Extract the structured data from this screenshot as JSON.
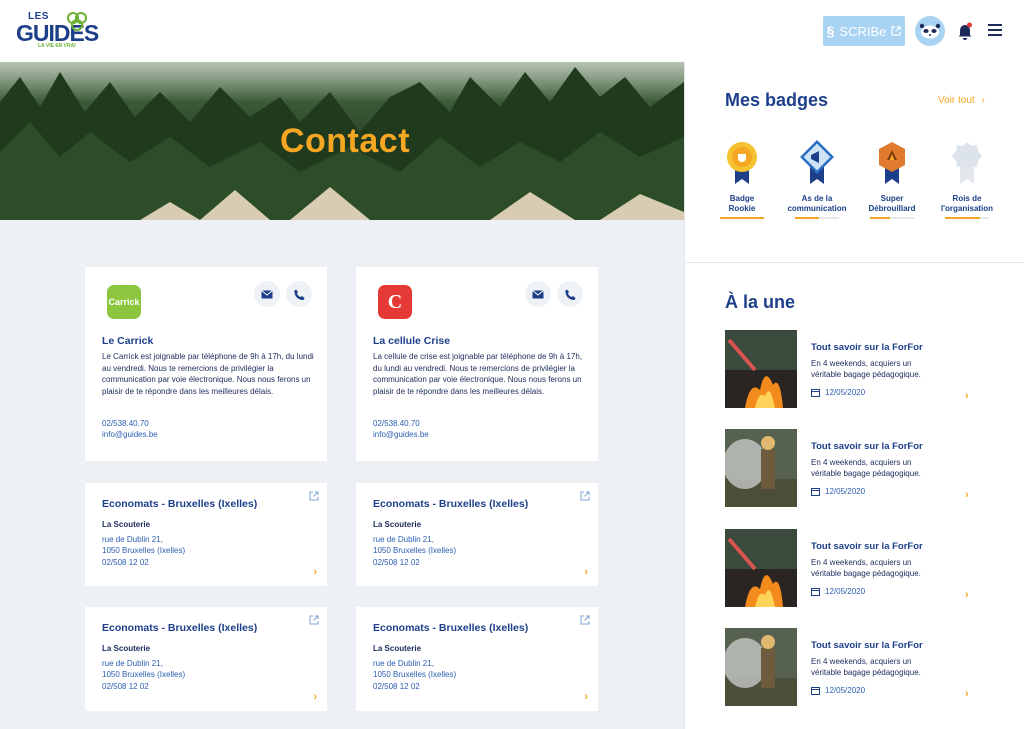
{
  "header": {
    "logo_top": "LES",
    "logo_main": "GUIDES",
    "logo_tagline": "LA VIE EN VRAI",
    "scribe_label": "SCRIBe"
  },
  "hero": {
    "title": "Contact"
  },
  "contacts": [
    {
      "name": "Le Carrick",
      "logo_text": "Carrick",
      "description": "Le Carrick est joignable par téléphone de 9h à 17h, du lundi au vendredi. Nous te remercions de privilégier la communication par voie électronique. Nous nous ferons un plaisir de te répondre dans les meilleures délais.",
      "phone": "02/538.40.70",
      "email": "info@guides.be"
    },
    {
      "name": "La cellule Crise",
      "logo_text": "C",
      "description": "La cellule de crise  est joignable par téléphone de 9h à 17h, du lundi au vendredi. Nous te remercions de privilégier la communication par voie électronique. Nous nous ferons un plaisir de te répondre dans les meilleures délais.",
      "phone": "02/538.40.70",
      "email": "info@guides.be"
    }
  ],
  "shops": [
    {
      "title": "Economats - Bruxelles (Ixelles)",
      "store": "La Scouterie",
      "street": "rue de Dublin 21,",
      "city": "1050 Bruxelles (Ixelles)",
      "phone": "02/508 12 02"
    },
    {
      "title": "Economats - Bruxelles (Ixelles)",
      "store": "La Scouterie",
      "street": "rue de Dublin 21,",
      "city": "1050 Bruxelles (Ixelles)",
      "phone": "02/508 12 02"
    },
    {
      "title": "Economats - Bruxelles (Ixelles)",
      "store": "La Scouterie",
      "street": "rue de Dublin 21,",
      "city": "1050 Bruxelles (Ixelles)",
      "phone": "02/508 12 02"
    },
    {
      "title": "Economats - Bruxelles (Ixelles)",
      "store": "La Scouterie",
      "street": "rue de Dublin 21,",
      "city": "1050 Bruxelles (Ixelles)",
      "phone": "02/508 12 02"
    }
  ],
  "sidebar": {
    "badges_title": "Mes badges",
    "see_all": "Voir tout",
    "badges": [
      {
        "line1": "Badge",
        "line2": "Rookie",
        "color": "#f5a623",
        "progress": 1.0
      },
      {
        "line1": "As de la",
        "line2": "communication",
        "color": "#2a6fc2",
        "progress": 0.55
      },
      {
        "line1": "Super",
        "line2": "Débrouillard",
        "color": "#e07a2e",
        "progress": 0.45
      },
      {
        "line1": "Rois de",
        "line2": "l'organisation",
        "color": "#c9d3df",
        "progress": 0.8
      }
    ],
    "news_title": "À la une",
    "news": [
      {
        "title": "Tout savoir sur la ForFor",
        "desc": "En 4 weekends, acquiers un véritable bagage pédagogique.",
        "date": "12/05/2020",
        "image": "fire"
      },
      {
        "title": "Tout savoir sur la ForFor",
        "desc": "En 4 weekends, acquiers un véritable bagage pédagogique.",
        "date": "12/05/2020",
        "image": "smoke"
      },
      {
        "title": "Tout savoir sur la ForFor",
        "desc": "En 4 weekends, acquiers un véritable bagage pédagogique.",
        "date": "12/05/2020",
        "image": "fire"
      },
      {
        "title": "Tout savoir sur la ForFor",
        "desc": "En 4 weekends, acquiers un véritable bagage pédagogique.",
        "date": "12/05/2020",
        "image": "smoke"
      }
    ]
  },
  "colors": {
    "brand_blue": "#1d3f8a",
    "accent_orange": "#f5a623",
    "scribe_bg": "#a9d3f2"
  }
}
